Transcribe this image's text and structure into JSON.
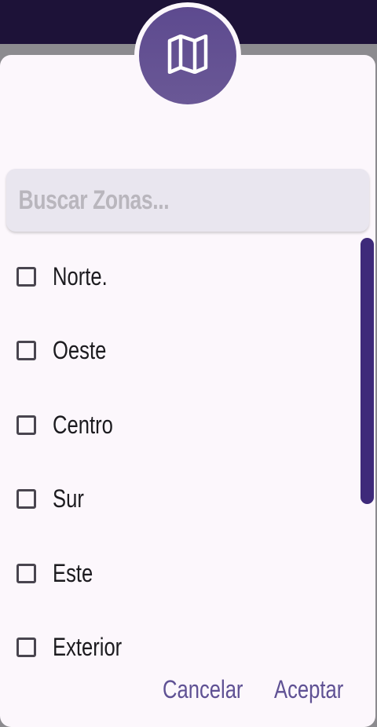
{
  "dialog": {
    "header_icon": "map-icon",
    "search": {
      "placeholder": "Buscar Zonas...",
      "value": ""
    },
    "items": [
      {
        "label": "Norte.",
        "checked": false
      },
      {
        "label": "Oeste",
        "checked": false
      },
      {
        "label": "Centro",
        "checked": false
      },
      {
        "label": "Sur",
        "checked": false
      },
      {
        "label": "Este",
        "checked": false
      },
      {
        "label": "Exterior",
        "checked": false
      }
    ],
    "cancel_label": "Cancelar",
    "accept_label": "Aceptar"
  },
  "colors": {
    "accent": "#5f5194",
    "app_bar": "#1d1238",
    "scrollbar": "#3e2a7a",
    "dialog_bg": "#fcf7fc",
    "search_bg": "#e9e6ef"
  }
}
